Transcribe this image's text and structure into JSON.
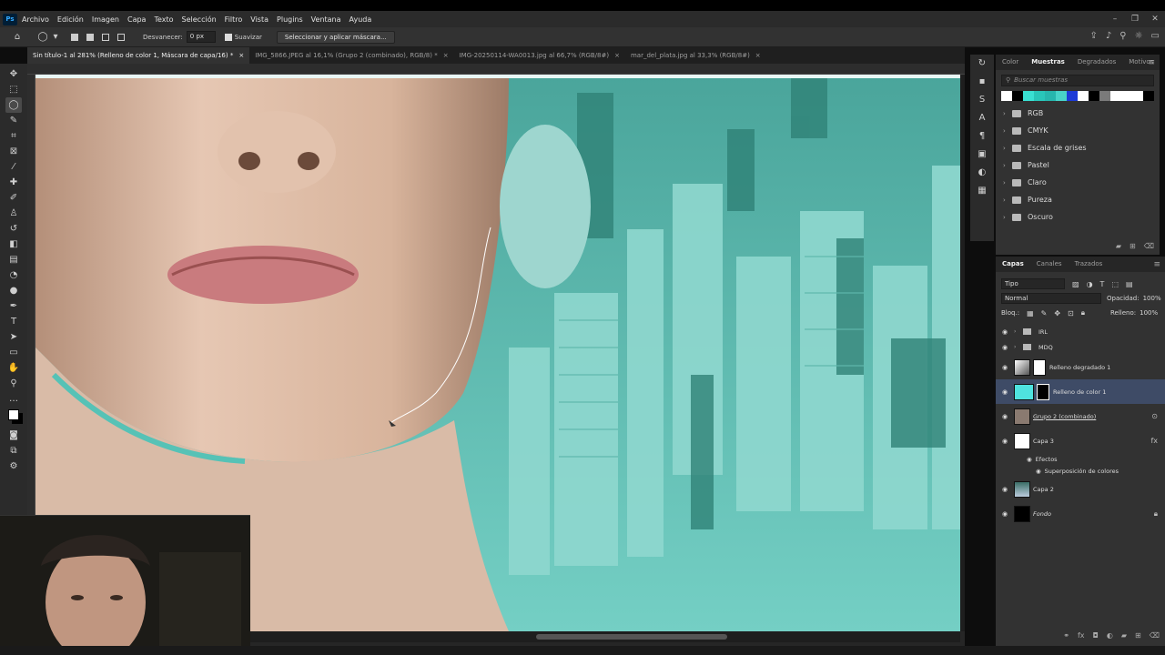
{
  "app": {
    "logo": "Ps"
  },
  "menu": [
    "Archivo",
    "Edición",
    "Imagen",
    "Capa",
    "Texto",
    "Selección",
    "Filtro",
    "Vista",
    "Plugins",
    "Ventana",
    "Ayuda"
  ],
  "window_controls": {
    "minimize": "–",
    "restore": "❐",
    "close": "✕"
  },
  "options": {
    "feather_label": "Desvanecer:",
    "feather_value": "0 px",
    "smooth_label": "Suavizar",
    "mask_button": "Seleccionar y aplicar máscara..."
  },
  "tabs": [
    {
      "label": "Sin título-1 al 281% (Relleno de color 1, Máscara de capa/16) *"
    },
    {
      "label": "IMG_5866.JPEG al 16,1% (Grupo 2 (combinado), RGB/8) *"
    },
    {
      "label": "IMG-20250114-WA0013.jpg al 66,7% (RGB/8#)"
    },
    {
      "label": "mar_del_plata.jpg al 33,3% (RGB/8#)"
    }
  ],
  "tab_close": "×",
  "swatches_panel": {
    "tabs": [
      "Color",
      "Muestras",
      "Degradados",
      "Motivos"
    ],
    "search_placeholder": "Buscar muestras",
    "swatch_colors": [
      "#ffffff",
      "#000000",
      "#39e0d2",
      "#29c6b9",
      "#27b6ad",
      "#48d3c8",
      "#1d3bd6",
      "#ffffff",
      "#000000",
      "#7a7a7a",
      "#ffffff",
      "#ffffff",
      "#ffffff",
      "#000000"
    ],
    "folders": [
      "RGB",
      "CMYK",
      "Escala de grises",
      "Pastel",
      "Claro",
      "Pureza",
      "Oscuro"
    ]
  },
  "layers_panel": {
    "tabs": [
      "Capas",
      "Canales",
      "Trazados"
    ],
    "filter_kind": "Tipo",
    "blend_mode": "Normal",
    "opacity_label": "Opacidad:",
    "opacity_value": "100%",
    "lock_label": "Bloq.:",
    "fill_label": "Relleno:",
    "fill_value": "100%",
    "layers": [
      {
        "name": "IRL",
        "type": "group"
      },
      {
        "name": "MDQ",
        "type": "group"
      },
      {
        "name": "Relleno degradado 1"
      },
      {
        "name": "Relleno de color 1",
        "selected": true
      },
      {
        "name": "Grupo 2 (combinado)"
      },
      {
        "name": "Capa 3"
      },
      {
        "name": "Capa 2"
      },
      {
        "name": "Fondo"
      }
    ],
    "effects_label": "Efectos",
    "effect_name": "Superposición de colores"
  }
}
